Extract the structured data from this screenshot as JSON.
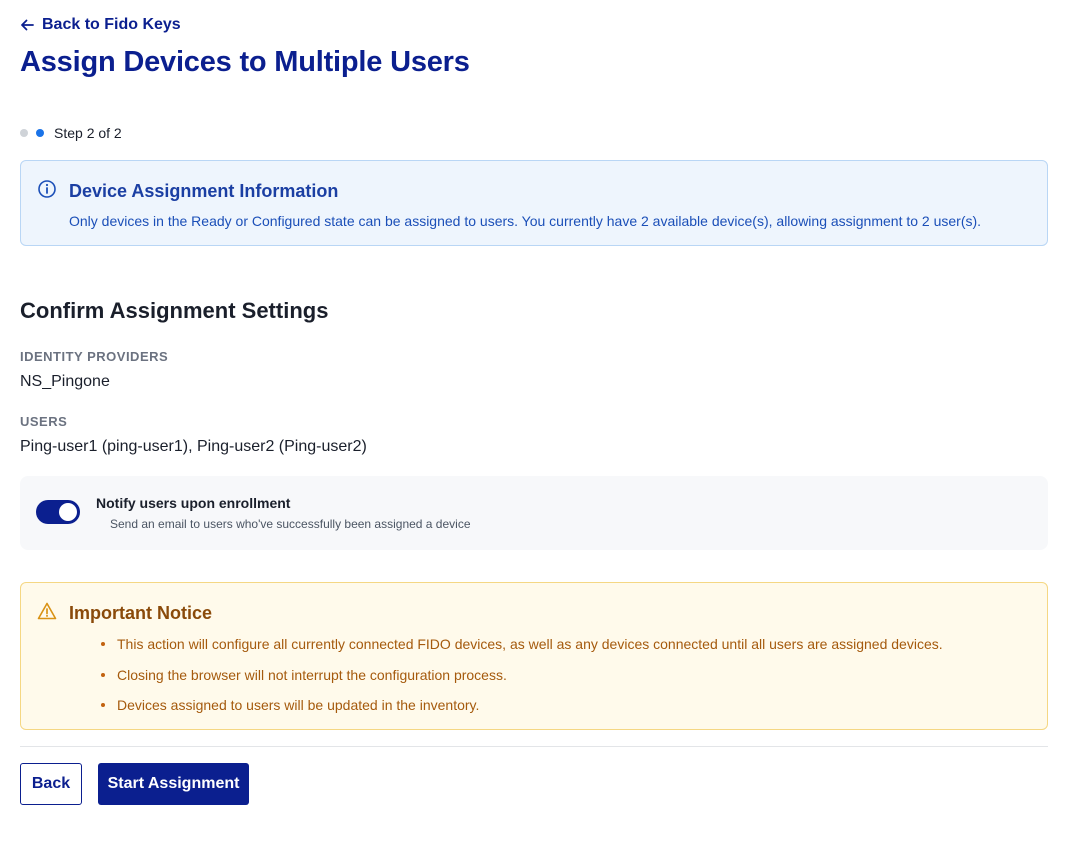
{
  "header": {
    "back_link_label": "Back to Fido Keys",
    "title": "Assign Devices to Multiple Users"
  },
  "stepper": {
    "step_text": "Step 2 of 2",
    "current_step": 2,
    "total_steps": 2
  },
  "info_banner": {
    "icon": "info-icon",
    "title": "Device Assignment Information",
    "text": "Only devices in the Ready or Configured state can be assigned to users. You currently have 2 available device(s), allowing assignment to 2 user(s)."
  },
  "confirm": {
    "section_title": "Confirm Assignment Settings",
    "identity_providers_label": "IDENTITY PROVIDERS",
    "identity_providers_value": "NS_Pingone",
    "users_label": "USERS",
    "users_value": "Ping-user1 (ping-user1), Ping-user2 (Ping-user2)"
  },
  "notify": {
    "enabled": true,
    "title": "Notify users upon enrollment",
    "subtitle": "Send an email to users who've successfully been assigned a device"
  },
  "notice": {
    "icon": "warning-icon",
    "title": "Important Notice",
    "items": [
      "This action will configure all currently connected FIDO devices, as well as any devices connected until all users are assigned devices.",
      "Closing the browser will not interrupt the configuration process.",
      "Devices assigned to users will be updated in the inventory."
    ]
  },
  "actions": {
    "back_label": "Back",
    "start_label": "Start Assignment"
  },
  "colors": {
    "primary": "#0b1f8f",
    "info_bg": "#eef5fd",
    "warning_bg": "#fffaeb",
    "step_active": "#1a73e8"
  }
}
